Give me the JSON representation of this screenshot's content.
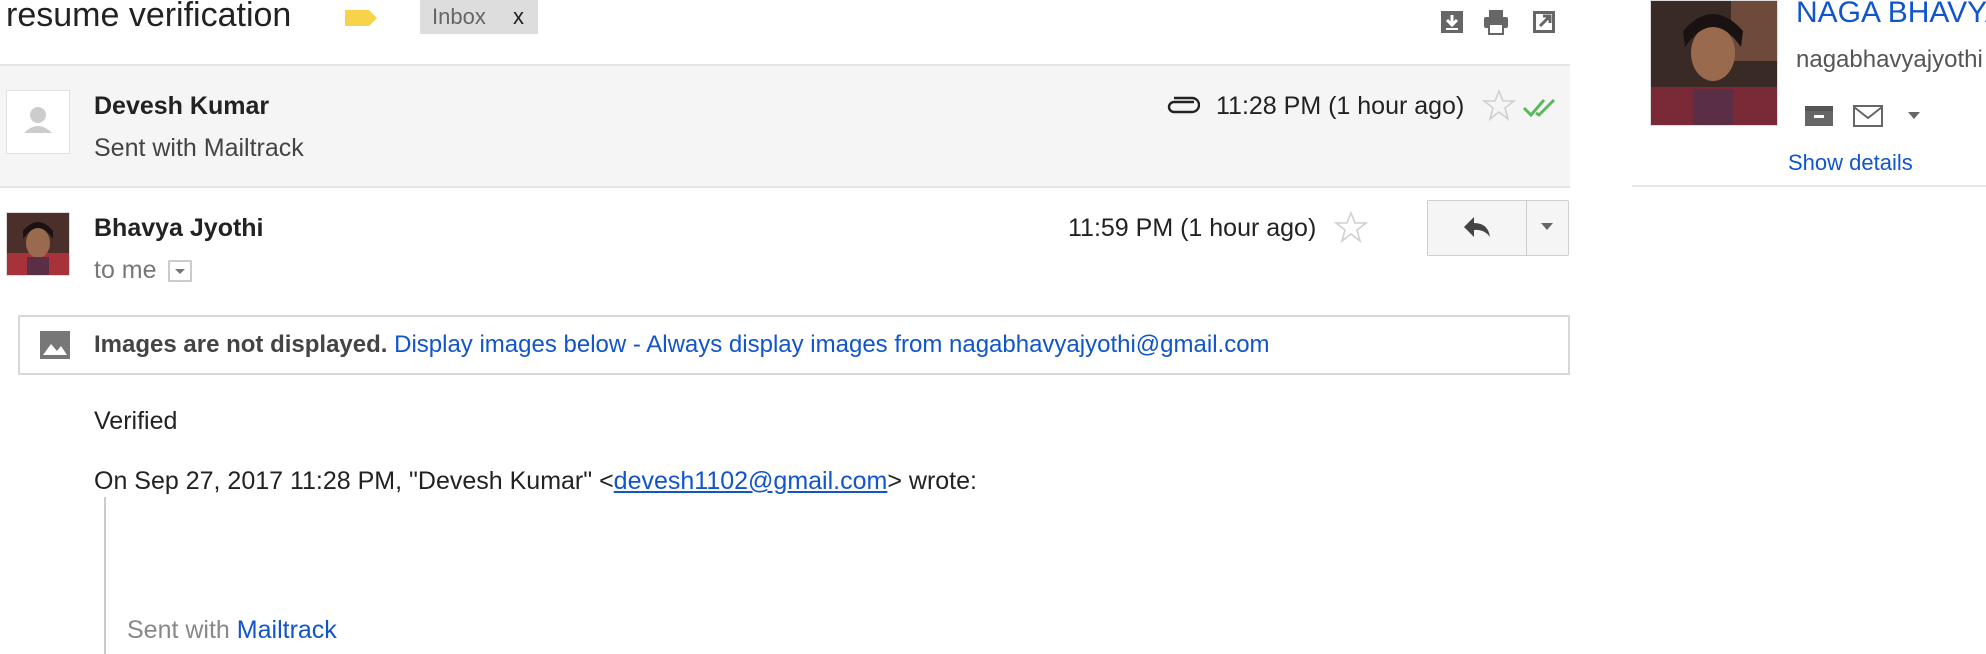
{
  "subject": "resume verification",
  "inbox_chip": {
    "label": "Inbox",
    "remove": "x"
  },
  "toolbar_icons": [
    "download-icon",
    "print-icon",
    "new-window-icon"
  ],
  "messages": [
    {
      "sender": "Bhavya Jyothi",
      "recipient": "to me",
      "time": "11:59 PM (1 hour ago)"
    }
  ],
  "collapsed_message": {
    "sender": "Devesh Kumar",
    "snippet": "Sent with Mailtrack",
    "time": "11:28 PM (1 hour ago)"
  },
  "images_banner": {
    "bold": "Images are not displayed.",
    "display_link": "Display images below",
    "separator": "-",
    "always_link": "Always display images from nagabhavyajyothi@gmail.com"
  },
  "body": {
    "line1": "Verified",
    "quote_prefix": "On Sep 27, 2017 11:28 PM, \"Devesh Kumar\" <",
    "quote_email": "devesh1102@gmail.com",
    "quote_suffix": "> wrote:",
    "sent_with": "Sent with",
    "mailtrack": "Mailtrack"
  },
  "side_panel": {
    "name": "NAGA BHAVYA",
    "email": "nagabhavyajyothi",
    "show_details": "Show details"
  },
  "colors": {
    "link": "#1155cc",
    "tag": "#f7d34b",
    "check": "#5cb85c"
  }
}
